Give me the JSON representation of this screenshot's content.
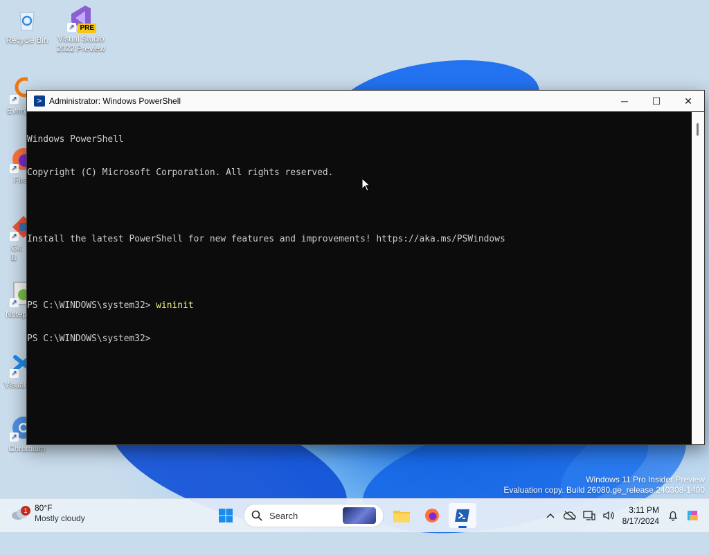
{
  "desktop": {
    "icons": [
      {
        "label": "Recycle Bin"
      },
      {
        "label": "Visual Studio 2022 Preview",
        "badge": "PRE"
      },
      {
        "label": "Every"
      },
      {
        "label": "Fire"
      },
      {
        "label": "Git B"
      },
      {
        "label": "Notep"
      },
      {
        "label": "Visual Co"
      },
      {
        "label": "Chromium"
      }
    ]
  },
  "window": {
    "title": "Administrator: Windows PowerShell",
    "icon": "powershell-icon",
    "controls": {
      "minimize": "─",
      "maximize": "☐",
      "close": "✕"
    },
    "console": {
      "lines": [
        "Windows PowerShell",
        "Copyright (C) Microsoft Corporation. All rights reserved.",
        "",
        "Install the latest PowerShell for new features and improvements! https://aka.ms/PSWindows",
        ""
      ],
      "prompt1": "PS C:\\WINDOWS\\system32> ",
      "command1": "wininit",
      "prompt2": "PS C:\\WINDOWS\\system32>"
    }
  },
  "watermark": {
    "line1": "Windows 11 Pro Insider Preview",
    "line2": "Evaluation copy. Build 26080.ge_release.240308-1400"
  },
  "taskbar": {
    "weather": {
      "badge": "1",
      "temp": "80°F",
      "condition": "Mostly cloudy"
    },
    "search": {
      "placeholder": "Search"
    },
    "apps": [
      "start-icon",
      "search-box",
      "file-explorer-icon",
      "firefox-icon",
      "powershell-icon"
    ],
    "clock": {
      "time": "3:11 PM",
      "date": "8/17/2024"
    },
    "colors": {
      "accent": "#0a5fd0",
      "console_bg": "#0c0c0c",
      "console_fg": "#cccccc",
      "command_fg": "#f2f28a"
    }
  }
}
